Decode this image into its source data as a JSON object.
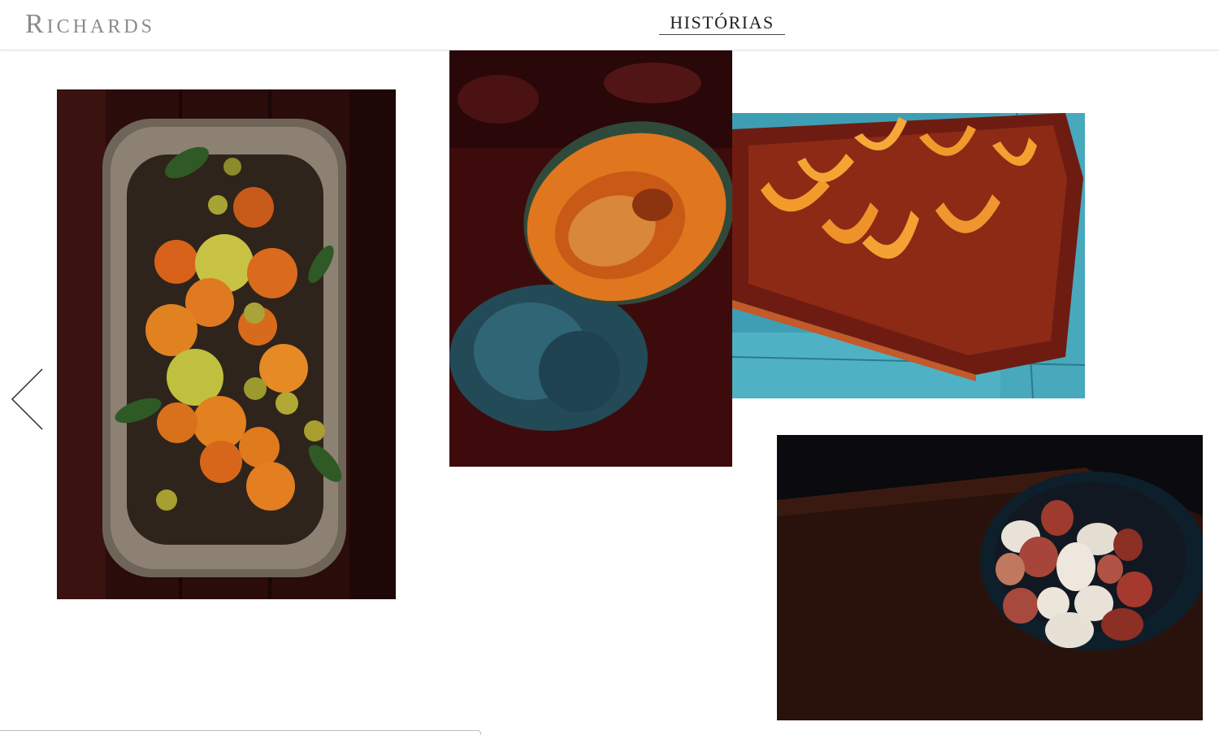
{
  "header": {
    "logo_text": "Richards",
    "nav_link": "HISTÓRIAS"
  },
  "gallery": {
    "prev_icon": "chevron-left-icon",
    "photos": [
      {
        "name": "citrus-bowl-photo",
        "subject": "wooden bowl of citrus fruits"
      },
      {
        "name": "pumpkin-photo",
        "subject": "halved pumpkin on blue squash"
      },
      {
        "name": "pumpkin-slices-photo",
        "subject": "pumpkin slices on cutting board"
      },
      {
        "name": "eggs-bowl-photo",
        "subject": "bowl of eggs on dark wood"
      }
    ]
  },
  "colors": {
    "text": "#222222",
    "logo": "#8a8a8a"
  }
}
